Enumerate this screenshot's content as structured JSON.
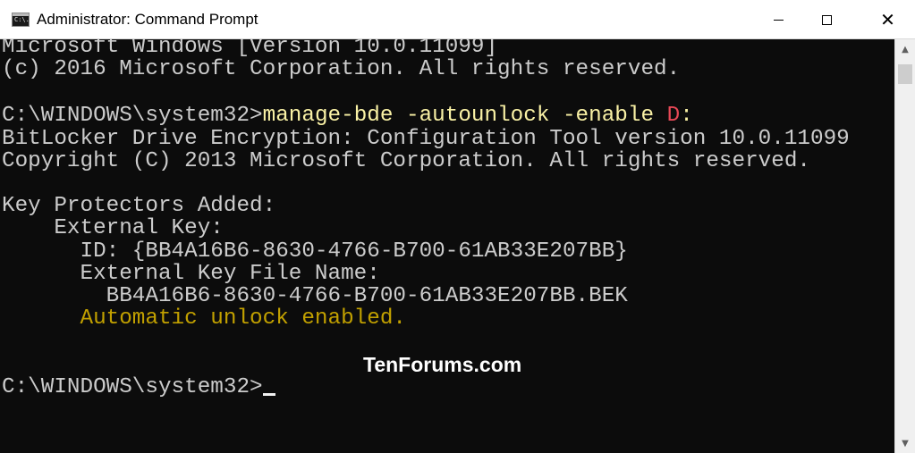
{
  "window": {
    "title": "Administrator: Command Prompt",
    "icon_text": "C:\\."
  },
  "controls": {
    "minimize_icon": "minimize-icon",
    "maximize_icon": "maximize-icon",
    "close_icon": "close-icon",
    "close_glyph": "✕"
  },
  "console": {
    "lines": [
      {
        "plain": "Microsoft Windows [Version 10.0.11099]"
      },
      {
        "plain": "(c) 2016 Microsoft Corporation. All rights reserved."
      },
      {
        "plain": ""
      },
      {
        "prompt": "C:\\WINDOWS\\system32>",
        "command": "manage-bde -autounlock -enable ",
        "drive": "D",
        "suffix": ":"
      },
      {
        "plain": "BitLocker Drive Encryption: Configuration Tool version 10.0.11099"
      },
      {
        "plain": "Copyright (C) 2013 Microsoft Corporation. All rights reserved."
      },
      {
        "plain": ""
      },
      {
        "plain": "Key Protectors Added:"
      },
      {
        "plain": "    External Key:"
      },
      {
        "plain": "      ID: {BB4A16B6-8630-4766-B700-61AB33E207BB}"
      },
      {
        "plain": "      External Key File Name:"
      },
      {
        "plain": "        BB4A16B6-8630-4766-B700-61AB33E207BB.BEK"
      },
      {
        "success": "      Automatic unlock enabled."
      },
      {
        "plain": ""
      },
      {
        "plain": ""
      },
      {
        "prompt_final": "C:\\WINDOWS\\system32>"
      }
    ]
  },
  "watermark": "TenForums.com",
  "colors": {
    "console_bg": "#0c0c0c",
    "console_text": "#cccccc",
    "command_text": "#f9f1a5",
    "drive_letter": "#e74856",
    "success_text": "#c1a000"
  }
}
